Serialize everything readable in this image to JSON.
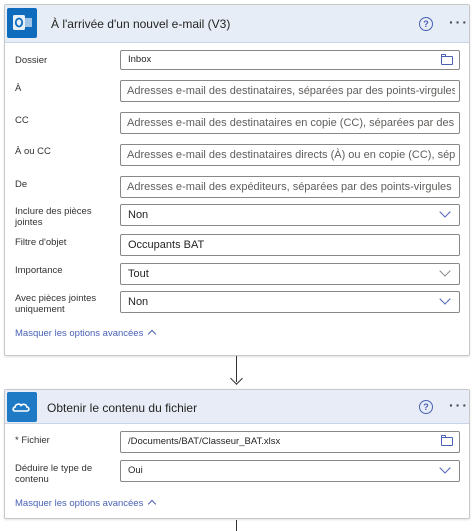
{
  "trigger": {
    "title": "À l'arrivée d'un nouvel e-mail (V3)",
    "icon": "outlook-icon",
    "fields": [
      {
        "label": "Dossier",
        "value": "Inbox",
        "placeholder": ""
      },
      {
        "label": "À",
        "value": "",
        "placeholder": "Adresses e-mail des destinataires, séparées par des points-virgules (Si l'une corres..."
      },
      {
        "label": "CC",
        "value": "",
        "placeholder": "Adresses e-mail des destinataires en copie (CC), séparées par des points-virgules"
      },
      {
        "label": "À ou CC",
        "value": "",
        "placeholder": "Adresses e-mail des destinataires directs (À) ou en copie (CC), séparées par des points"
      },
      {
        "label": "De",
        "value": "",
        "placeholder": "Adresses e-mail des expéditeurs, séparées par des points-virgules (Si l'une correspond"
      },
      {
        "label": "Inclure des pièces jointes",
        "value": "Non",
        "placeholder": ""
      },
      {
        "label": "Filtre d'objet",
        "value": "Occupants BAT",
        "placeholder": ""
      },
      {
        "label": "Importance",
        "value": "Tout",
        "placeholder": ""
      },
      {
        "label": "Avec pièces jointes uniquement",
        "value": "Non",
        "placeholder": ""
      }
    ],
    "advanced_toggle": "Masquer les options avancées"
  },
  "action": {
    "title": "Obtenir le contenu du fichier",
    "icon": "onedrive-icon",
    "fields": [
      {
        "label": "* Fichier",
        "value": "/Documents/BAT/Classeur_BAT.xlsx",
        "placeholder": ""
      },
      {
        "label": "Déduire le type de contenu",
        "value": "Oui",
        "placeholder": ""
      }
    ],
    "advanced_toggle": "Masquer les options avancées"
  },
  "colors": {
    "accent": "#4a61b5",
    "header_bg": "#e6edf7",
    "outlook_blue": "#0f6cbd",
    "onedrive_blue": "#1e7ac4"
  }
}
